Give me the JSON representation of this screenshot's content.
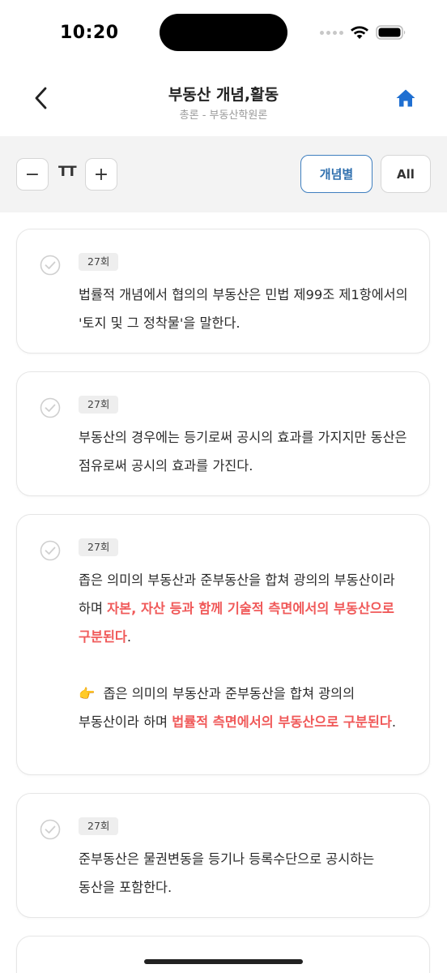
{
  "status_bar": {
    "time": "10:20"
  },
  "header": {
    "title": "부동산 개념,활동",
    "subtitle": "총론 - 부동산학원론"
  },
  "toolbar": {
    "decrease_label": "−",
    "font_size_label": "TT",
    "increase_label": "+",
    "filter_concept_label": "개념별",
    "filter_all_label": "All"
  },
  "cards": [
    {
      "badge": "27회",
      "text": "법률적 개념에서 협의의 부동산은 민법 제99조 제1항에서의 '토지 및 그 정착물'을 말한다."
    },
    {
      "badge": "27회",
      "text": "부동산의 경우에는 등기로써 공시의 효과를 가지지만 동산은 점유로써 공시의 효과를 가진다."
    },
    {
      "badge": "27회",
      "text_plain": "좁은 의미의 부동산과 준부동산을 합쳐 광의의 부동산이라 하며 ",
      "text_highlight": "자본, 자산 등과 함께 기술적 측면에서의 부동산으로 구분된다",
      "text_end": ".",
      "note_icon": "👉",
      "note_plain": "좁은 의미의 부동산과 준부동산을 합쳐 광의의 부동산이라 하며 ",
      "note_highlight": "법률적 측면에서의 부동산으로 구분된다",
      "note_end": "."
    },
    {
      "badge": "27회",
      "text": "준부동산은 물권변동을 등기나 등록수단으로 공시하는 동산을 포함한다."
    }
  ],
  "colors": {
    "highlight": "#f05a5a",
    "accent_blue": "#2f6fae",
    "home_icon": "#1f6fd1"
  }
}
